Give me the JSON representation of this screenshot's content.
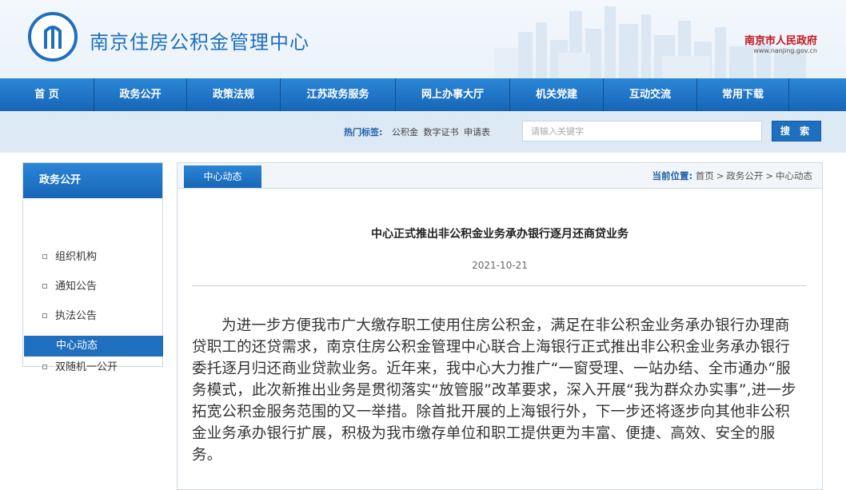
{
  "header": {
    "site_title": "南京住房公积金管理中心",
    "gov_name": "南京市人民政府",
    "gov_url": "www.nanjing.gov.cn"
  },
  "nav": {
    "items": [
      "首 页",
      "政务公开",
      "政策法规",
      "江苏政务服务",
      "网上办事大厅",
      "机关党建",
      "互动交流",
      "常用下载"
    ]
  },
  "search": {
    "hot_label": "热门标签:",
    "hot_tags": [
      "公积金",
      "数字证书",
      "申请表"
    ],
    "placeholder": "请输入关键字",
    "button_label": "搜 索"
  },
  "sidebar": {
    "title": "政务公开",
    "items": [
      {
        "label": "组织机构"
      },
      {
        "label": "通知公告"
      },
      {
        "label": "执法公告"
      },
      {
        "label": "中心动态"
      },
      {
        "label": "双随机一公开"
      }
    ],
    "active_index": 3
  },
  "main": {
    "tab_label": "中心动态",
    "breadcrumb": {
      "label": "当前位置:",
      "items": [
        "首页",
        "政务公开",
        "中心动态"
      ],
      "separator": ">"
    },
    "article": {
      "title": "中心正式推出非公积金业务承办银行逐月还商贷业务",
      "date": "2021-10-21",
      "body": "为进一步方便我市广大缴存职工使用住房公积金，满足在非公积金业务承办银行办理商贷职工的还贷需求，南京住房公积金管理中心联合上海银行正式推出非公积金业务承办银行委托逐月归还商业贷款业务。近年来，我中心大力推广“一窗受理、一站办结、全市通办”服务模式，此次新推出业务是贯彻落实“放管服”改革要求，深入开展“我为群众办实事”,进一步拓宽公积金服务范围的又一举措。除首批开展的上海银行外，下一步还将逐步向其他非公积金业务承办银行扩展，积极为我市缴存单位和职工提供更为丰富、便捷、高效、安全的服务。"
    }
  },
  "colors": {
    "brand_blue": "#1f6fbf",
    "gov_red": "#c4161c",
    "search_bar_bg": "#dde9f5"
  },
  "icons": {
    "site_logo": "housing-fund-logo-icon",
    "gov_logo": "nanjing-gov-logo",
    "bullet": "square-bullet-icon"
  }
}
